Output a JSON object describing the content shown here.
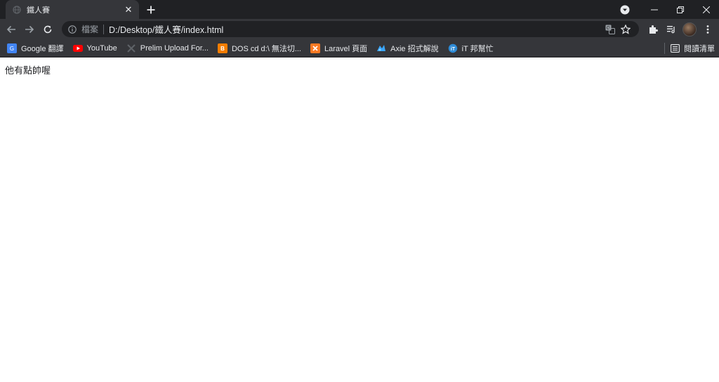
{
  "tab": {
    "title": "鐵人賽",
    "close_icon": "close-icon",
    "favicon": "globe-icon"
  },
  "window": {
    "new_tab_icon": "plus-icon",
    "tab_search_icon": "dropdown-circle-icon"
  },
  "toolbar": {
    "omnibox": {
      "security_label": "檔案",
      "url": "D:/Desktop/鐵人賽/index.html"
    }
  },
  "bookmarks": [
    {
      "label": "Google 翻譯",
      "icon": "google-translate-icon",
      "color": "#4285f4"
    },
    {
      "label": "YouTube",
      "icon": "youtube-icon",
      "color": "#ff0000"
    },
    {
      "label": "Prelim Upload For...",
      "icon": "x-mark-icon",
      "color": "#5f6368"
    },
    {
      "label": "DOS cd d:\\ 無法切...",
      "icon": "blogger-icon",
      "color": "#f57d00"
    },
    {
      "label": "Laravel 頁面",
      "icon": "xampp-icon",
      "color": "#fb7a24"
    },
    {
      "label": "Axie 招式解說",
      "icon": "axie-icon",
      "color": "#3aa7ff"
    },
    {
      "label": "iT 邦幫忙",
      "icon": "ithelp-icon",
      "color": "#2e8bd6"
    }
  ],
  "reading_list": {
    "label": "閱讀清單"
  },
  "page": {
    "text": "他有點帥喔"
  }
}
